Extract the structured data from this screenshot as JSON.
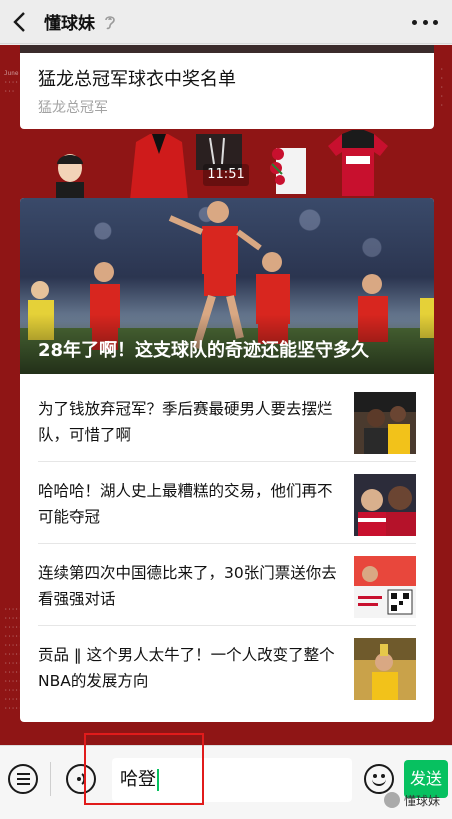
{
  "navbar": {
    "back_icon": "chevron-left-icon",
    "title": "懂球妹",
    "ear_icon": "ear-icon",
    "more_icon": "more-dots-icon"
  },
  "top_card": {
    "title": "猛龙总冠军球衣中奖名单",
    "subtitle": "猛龙总冠军"
  },
  "timestamp": "11:51",
  "hero": {
    "title": "28年了啊！这支球队的奇迹还能坚守多久"
  },
  "news_items": [
    {
      "text": "为了钱放弃冠军？季后赛最硬男人要去摆烂队，可惜了啊"
    },
    {
      "text": "哈哈哈！湖人史上最糟糕的交易，他们再不可能夺冠"
    },
    {
      "text": "连续第四次中国德比来了，30张门票送你去看强强对话"
    },
    {
      "text": "贡品 ‖ 这个男人太牛了！一个人改变了整个NBA的发展方向"
    }
  ],
  "input": {
    "value": "哈登"
  },
  "send_label": "发送",
  "watermark": "懂球妹",
  "colors": {
    "accent_red": "#8f1515",
    "send_green": "#07c160",
    "highlight_red": "#e11b1b"
  }
}
